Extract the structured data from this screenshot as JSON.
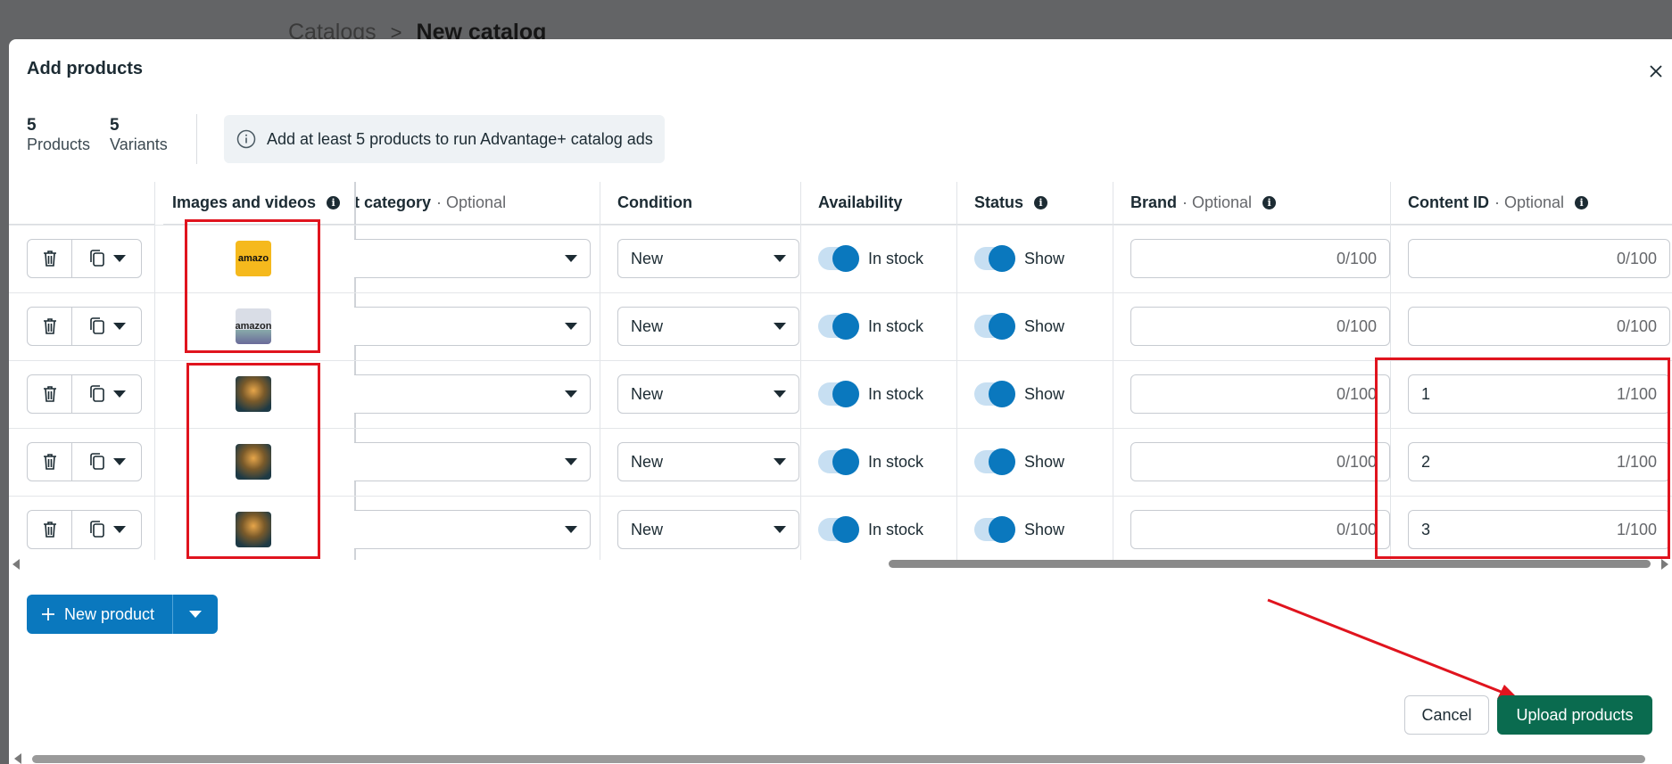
{
  "background": {
    "breadcrumb": {
      "parent": "Catalogs",
      "separator": ">",
      "current": "New catalog"
    }
  },
  "modal": {
    "title": "Add products",
    "close_icon": "close-icon"
  },
  "stats": {
    "products_count": "5",
    "products_label": "Products",
    "variants_count": "5",
    "variants_label": "Variants"
  },
  "notice": {
    "icon": "info-icon",
    "text": "Add at least 5 products to run Advantage+ catalog ads"
  },
  "columns": {
    "images": "Images and videos",
    "category": "t category",
    "category_opt": "· Optional",
    "condition": "Condition",
    "availability": "Availability",
    "status": "Status",
    "brand": "Brand",
    "brand_opt": "· Optional",
    "content_id": "Content ID",
    "content_id_opt": "· Optional"
  },
  "rows": [
    {
      "thumb_label": "amazo",
      "condition": "New",
      "availability": "In stock",
      "status": "Show",
      "brand_count": "0/100",
      "content_id": "",
      "content_count": "0/100"
    },
    {
      "thumb_label": "amazon",
      "condition": "New",
      "availability": "In stock",
      "status": "Show",
      "brand_count": "0/100",
      "content_id": "",
      "content_count": "0/100"
    },
    {
      "thumb_label": "",
      "condition": "New",
      "availability": "In stock",
      "status": "Show",
      "brand_count": "0/100",
      "content_id": "1",
      "content_count": "1/100"
    },
    {
      "thumb_label": "",
      "condition": "New",
      "availability": "In stock",
      "status": "Show",
      "brand_count": "0/100",
      "content_id": "2",
      "content_count": "1/100"
    },
    {
      "thumb_label": "",
      "condition": "New",
      "availability": "In stock",
      "status": "Show",
      "brand_count": "0/100",
      "content_id": "3",
      "content_count": "1/100"
    }
  ],
  "footer": {
    "new_product_label": "New product",
    "cancel_label": "Cancel",
    "upload_label": "Upload products"
  },
  "colors": {
    "primary_blue": "#0a78be",
    "upload_green": "#0a6b4f",
    "annotation_red": "#e0141e"
  }
}
